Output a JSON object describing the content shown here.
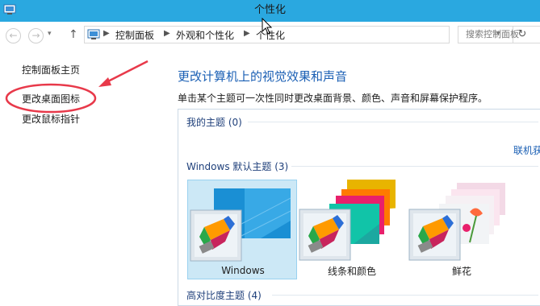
{
  "window": {
    "title": "个性化"
  },
  "navbar": {
    "breadcrumbs": [
      "控制面板",
      "外观和个性化",
      "个性化"
    ],
    "search_placeholder": "搜索控制面板"
  },
  "sidebar": {
    "items": [
      {
        "label": "控制面板主页"
      },
      {
        "label": "更改桌面图标"
      },
      {
        "label": "更改鼠标指针"
      }
    ]
  },
  "main": {
    "title": "更改计算机上的视觉效果和声音",
    "description": "单击某个主题可一次性同时更改桌面背景、颜色、声音和屏幕保护程序。",
    "my_themes_header": "我的主题 (0)",
    "online_link": "联机获",
    "default_themes_header": "Windows 默认主题 (3)",
    "high_contrast_header": "高对比度主题 (4)",
    "themes": [
      {
        "name": "Windows",
        "icon": "windows-theme-icon",
        "selected": true
      },
      {
        "name": "线条和颜色",
        "icon": "lines-colors-theme-icon",
        "selected": false
      },
      {
        "name": "鲜花",
        "icon": "flowers-theme-icon",
        "selected": false
      }
    ]
  },
  "colors": {
    "titlebar": "#2aa8e0",
    "link": "#1a5fb4",
    "annotation": "#e8394a",
    "selected_card": "#cce8f6"
  }
}
